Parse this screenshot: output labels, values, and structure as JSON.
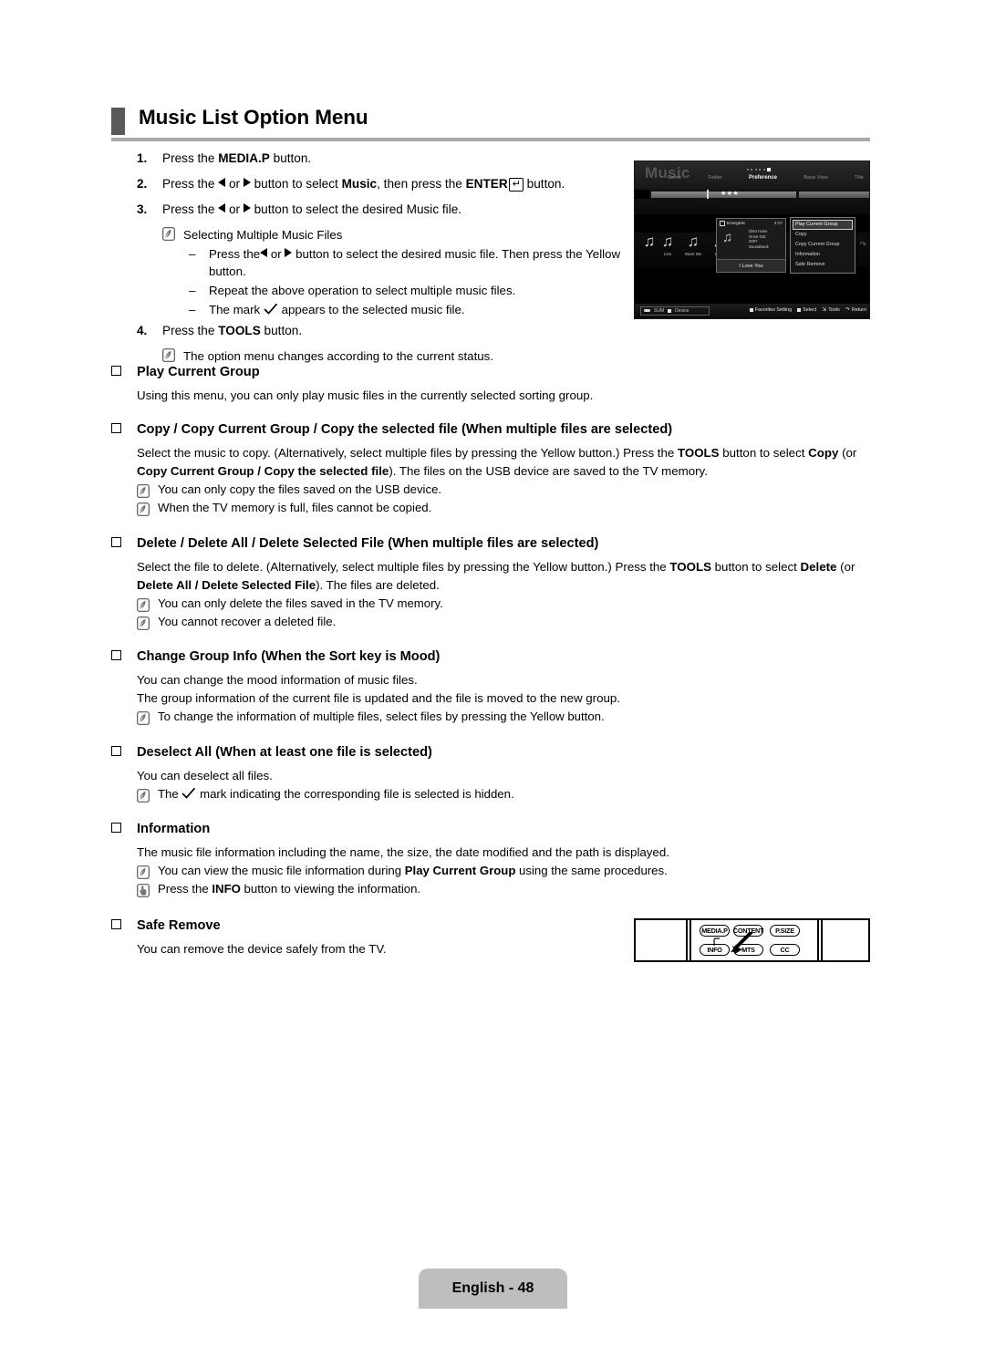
{
  "header": {
    "title": "Music List Option Menu"
  },
  "steps": [
    {
      "num": "1.",
      "pre": "Press the ",
      "bold": "MEDIA.P",
      "post": " button."
    },
    {
      "num": "2.",
      "pre": "Press the ",
      "mid": " or ",
      "post": " button to select ",
      "bold": "Music",
      "post2": ", then press the ",
      "bold2": "ENTER",
      "post3": " button."
    },
    {
      "num": "3.",
      "text": "Press the ◀ or ▶ button to select the desired Music file."
    },
    {
      "num": "4.",
      "pre": "Press the ",
      "bold": "TOOLS",
      "post": " button."
    }
  ],
  "step3_note": "Selecting Multiple Music Files",
  "step3_dashes": [
    "Press the ◀ or ▶ button to select the desired music file. Then press the Yellow button.",
    "Repeat the above operation to select multiple music files.",
    "The mark ✓ appears to the selected music file."
  ],
  "step3_dash1_a": "Press the",
  "step3_dash1_b": " or ",
  "step3_dash1_c": " button to select the desired music file. Then press the Yellow button.",
  "step3_dash2": "Repeat the above operation to select multiple music files.",
  "step3_dash3_a": "The mark",
  "step3_dash3_b": "appears to the selected music file.",
  "step4_note": "The option menu changes according to the current status.",
  "tv": {
    "heading": "Music",
    "nav": [
      "Genre",
      "Folder",
      "Preference",
      "Basic View",
      "Title"
    ],
    "selected_nav": "Preference",
    "rating_stars": "★★★",
    "thumbs": [
      {
        "label": "Lies"
      },
      {
        "label": "Want Me"
      },
      {
        "label": "Way"
      }
    ],
    "info": {
      "mood": "Energetic",
      "duration": "3:27",
      "meta_lines": [
        "Glen Hans",
        "Once Ost",
        "2007",
        "Soundtrack"
      ],
      "title": "I Love You"
    },
    "menu": [
      "Play Current Group",
      "Copy",
      "Copy Current Group",
      "Information",
      "Safe Remove"
    ],
    "menu_selected": "Play Current Group",
    "footer": {
      "source": "SUM",
      "device": "Device",
      "favorites": "Favorites Setting",
      "select": "Select",
      "tools": "Tools",
      "return": "Return"
    }
  },
  "sections": [
    {
      "heading": "Play Current Group",
      "paras": [
        "Using this menu, you can only play music files in the currently selected sorting group."
      ],
      "notes": []
    },
    {
      "heading": "Copy / Copy Current Group / Copy the selected file (When multiple files are selected)",
      "para_a": "Select the music to copy. (Alternatively, select multiple files by pressing the Yellow button.) Press the ",
      "para_b": "TOOLS",
      "para_c": " button to select ",
      "para_d": "Copy",
      "para_e": " (or ",
      "para_f": "Copy Current Group / Copy the selected file",
      "para_g": "). The files on the USB device are saved to the TV memory.",
      "notes": [
        "You can only copy the files saved on the USB device.",
        "When the TV memory is full, files cannot be copied."
      ]
    },
    {
      "heading": "Delete / Delete All / Delete Selected File (When multiple files are selected)",
      "para_a": "Select the file to delete. (Alternatively, select multiple files by pressing the Yellow button.) Press the ",
      "para_b": "TOOLS",
      "para_c": " button to select ",
      "para_d": "Delete",
      "para_e": " (or ",
      "para_f": "Delete All / Delete Selected File",
      "para_g": "). The files are deleted.",
      "notes": [
        "You can only delete the files saved in the TV memory.",
        "You cannot recover a deleted file."
      ]
    },
    {
      "heading": "Change Group Info (When the Sort key is Mood)",
      "paras": [
        "You can change the mood information of music files.",
        "The group information of the current file is updated and the file is moved to the new group."
      ],
      "notes": [
        "To change the information of multiple files, select files by pressing the Yellow button."
      ]
    },
    {
      "heading": "Deselect All (When at least one file is selected)",
      "paras": [
        "You can deselect all files."
      ],
      "note_a": "The",
      "note_b": "mark indicating the corresponding file is selected is hidden."
    },
    {
      "heading": "Information",
      "paras": [
        "The music file information including the name, the size, the date modified and the path is displayed."
      ],
      "note1_a": "You can view the music file information during ",
      "note1_b": "Play Current Group",
      "note1_c": " using the same procedures.",
      "note2_a": "Press the ",
      "note2_b": "INFO",
      "note2_c": " button to viewing the information."
    },
    {
      "heading": "Safe Remove",
      "paras": [
        "You can remove the device safely from the TV."
      ],
      "notes": []
    }
  ],
  "remote": {
    "buttons_top": [
      "MEDIA.P",
      "CONTENT",
      "P.SIZE"
    ],
    "buttons_bottom": [
      "INFO",
      "MTS",
      "CC"
    ]
  },
  "footer": {
    "label": "English - 48"
  }
}
